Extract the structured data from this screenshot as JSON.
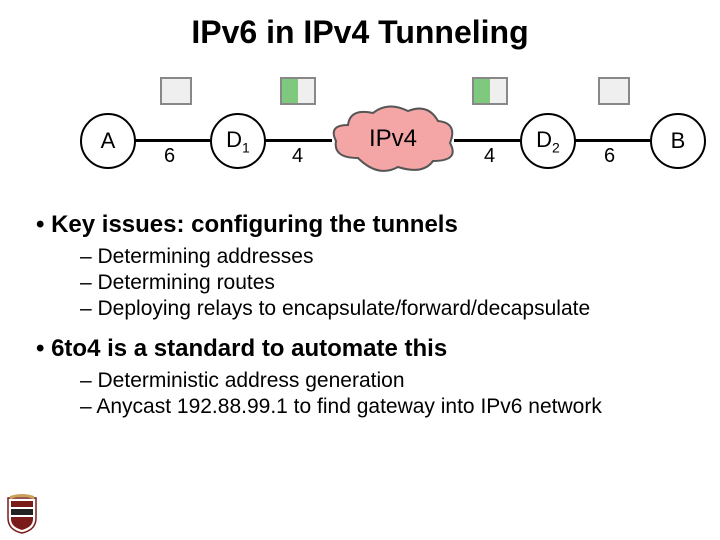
{
  "title": "IPv6 in IPv4 Tunneling",
  "diagram": {
    "nodes": {
      "a": "A",
      "d1": "D",
      "d1_sub": "1",
      "cloud": "IPv4",
      "d2": "D",
      "d2_sub": "2",
      "b": "B"
    },
    "links": {
      "ad1": "6",
      "d1cloud": "4",
      "cloudd2": "4",
      "d2b": "6"
    }
  },
  "bullets": {
    "b1": "Key issues: configuring the tunnels",
    "b1_subs": {
      "s1": "Determining addresses",
      "s2": "Determining routes",
      "s3": "Deploying relays to encapsulate/forward/decapsulate"
    },
    "b2": "6to4 is a standard to automate this",
    "b2_subs": {
      "s1": "Deterministic address generation",
      "s2": "Anycast 192.88.99.1 to find gateway into IPv6 network"
    }
  }
}
